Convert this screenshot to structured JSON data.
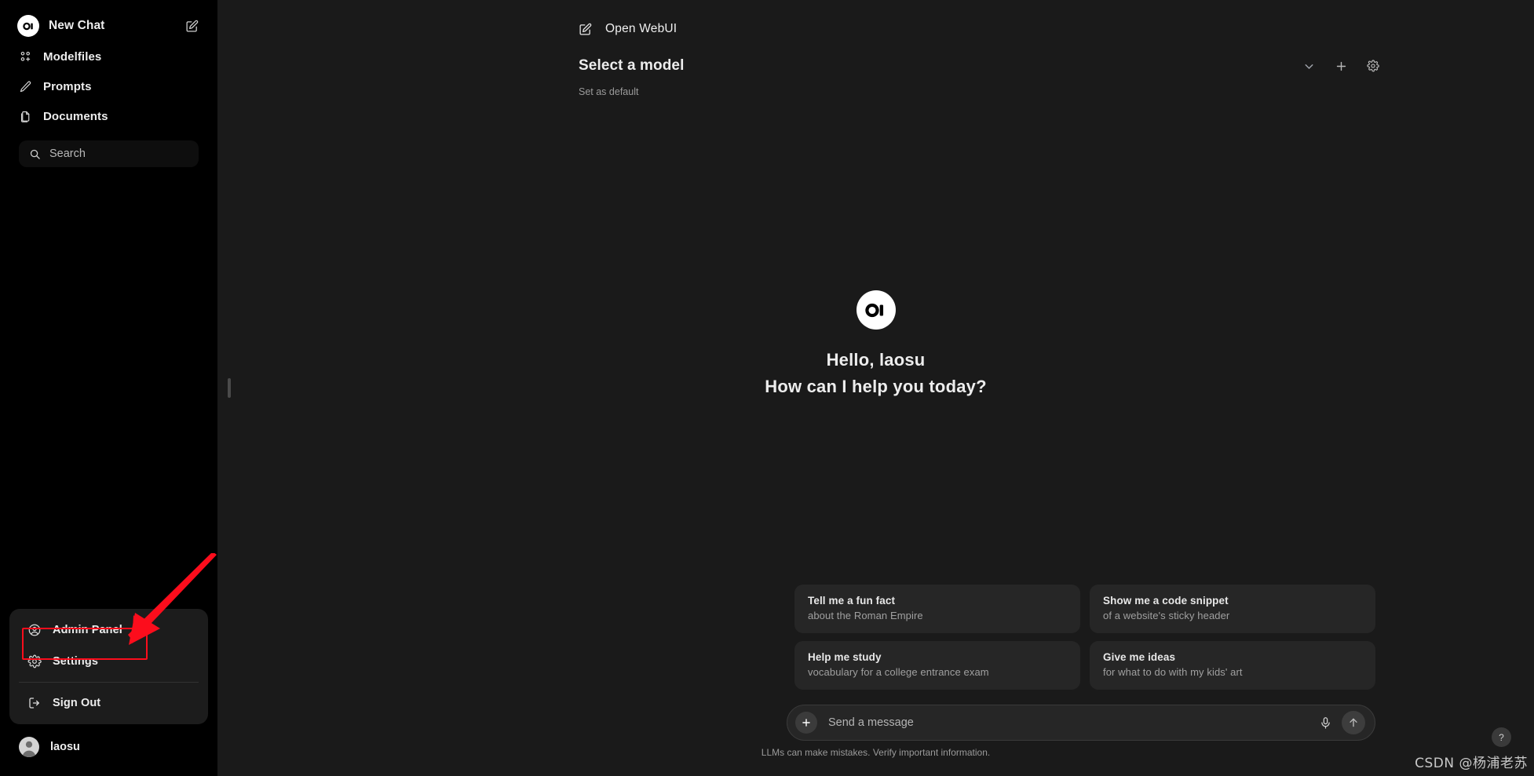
{
  "theme": {
    "sidebar_bg": "#000000",
    "main_bg": "#1a1a1a",
    "card_bg": "#262626",
    "menu_bg": "#1c1c1c",
    "text": "#ededed",
    "muted_text": "#a0a0a0",
    "annotation_red": "#fc0d1c"
  },
  "sidebar": {
    "new_chat": {
      "label": "New Chat",
      "logo": "openwebui-logo",
      "edit_icon": "edit-square-icon"
    },
    "nav_items": [
      {
        "label": "Modelfiles",
        "icon": "modelfiles-icon"
      },
      {
        "label": "Prompts",
        "icon": "pencil-icon"
      },
      {
        "label": "Documents",
        "icon": "documents-copy-icon"
      }
    ],
    "search": {
      "placeholder": "Search",
      "icon": "search-icon"
    },
    "menu_items": [
      {
        "label": "Admin Panel",
        "icon": "user-circle-icon"
      },
      {
        "label": "Settings",
        "icon": "gear-icon",
        "highlighted": true
      }
    ],
    "sign_out": {
      "label": "Sign Out",
      "icon": "logout-icon"
    },
    "profile": {
      "name": "laosu",
      "avatar": "user-avatar"
    }
  },
  "main": {
    "app_link": {
      "label": "Open WebUI",
      "icon": "edit-square-icon"
    },
    "model_selector": {
      "label": "Select a model",
      "set_default_label": "Set as default",
      "actions": [
        {
          "name": "chevron-down-icon"
        },
        {
          "name": "plus-icon"
        },
        {
          "name": "gear-icon"
        }
      ]
    },
    "greeting": {
      "logo": "openwebui-logo",
      "hello": "Hello, laosu",
      "question": "How can I help you today?"
    },
    "suggestions": [
      {
        "title": "Tell me a fun fact",
        "subtitle": "about the Roman Empire"
      },
      {
        "title": "Show me a code snippet",
        "subtitle": "of a website's sticky header"
      },
      {
        "title": "Help me study",
        "subtitle": "vocabulary for a college entrance exam"
      },
      {
        "title": "Give me ideas",
        "subtitle": "for what to do with my kids' art"
      }
    ],
    "composer": {
      "placeholder": "Send a message",
      "plus_icon": "plus-icon",
      "mic_icon": "microphone-icon",
      "send_icon": "arrow-up-icon"
    },
    "disclaimer": "LLMs can make mistakes. Verify important information."
  },
  "overlay": {
    "watermark": "CSDN @杨浦老苏",
    "help_button": "?"
  }
}
